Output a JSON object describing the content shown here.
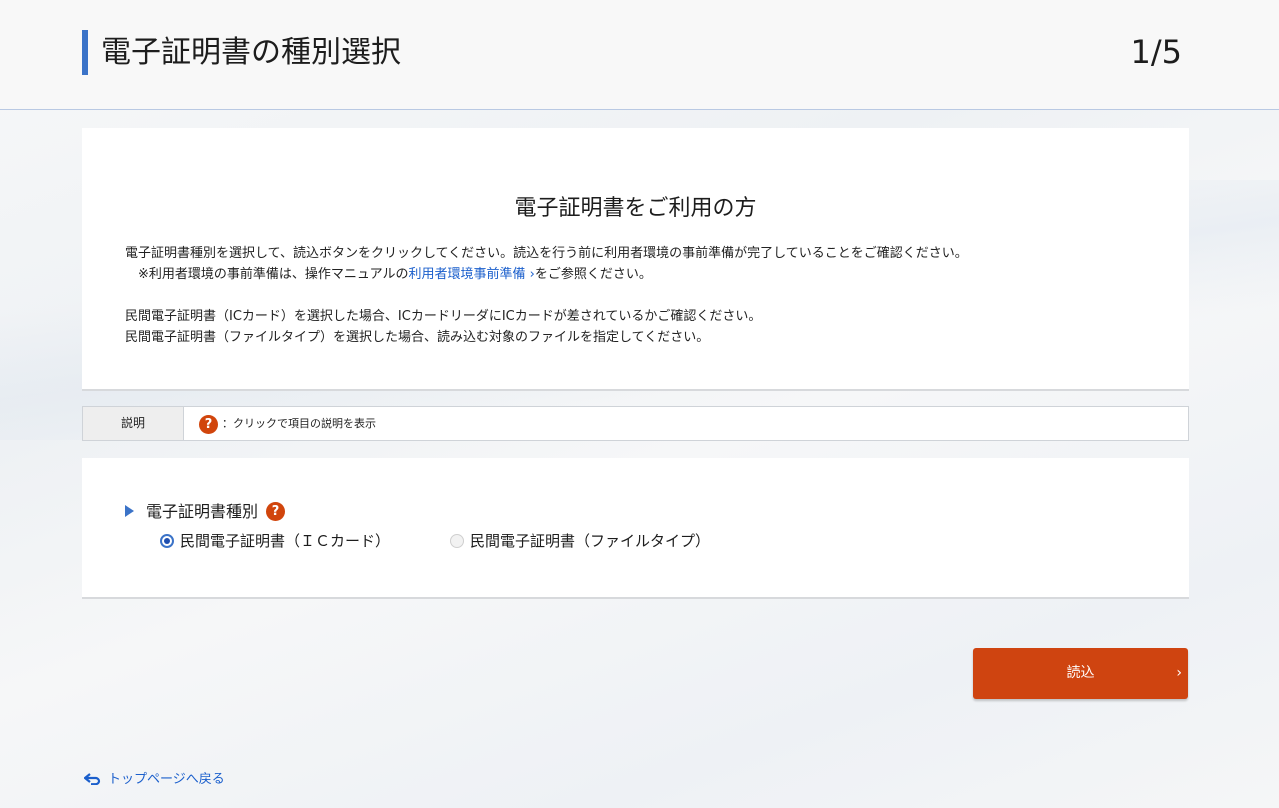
{
  "header": {
    "title": "電子証明書の種別選択",
    "step": "1/5"
  },
  "info": {
    "title": "電子証明書をご利用の方",
    "line1": "電子証明書種別を選択して、読込ボタンをクリックしてください。読込を行う前に利用者環境の事前準備が完了していることをご確認ください。",
    "line2_prefix": "※利用者環境の事前準備は、操作マニュアルの",
    "line2_link": "利用者環境事前準備",
    "line2_suffix": "をご参照ください。",
    "line3": "民間電子証明書（ICカード）を選択した場合、ICカードリーダにICカードが差されているかご確認ください。",
    "line4": "民間電子証明書（ファイルタイプ）を選択した場合、読み込む対象のファイルを指定してください。"
  },
  "description": {
    "label": "説明",
    "text": "：クリックで項目の説明を表示"
  },
  "form": {
    "field_label": "電子証明書種別",
    "options": [
      {
        "label": "民間電子証明書（ＩＣカード）",
        "selected": true
      },
      {
        "label": "民間電子証明書（ファイルタイプ）",
        "selected": false
      }
    ]
  },
  "buttons": {
    "read": "読込",
    "read_chevron": "›"
  },
  "footer": {
    "back_link": "トップページへ戻る"
  },
  "icons": {
    "help": "?",
    "link_chevron": "›"
  },
  "colors": {
    "accent": "#3b73c8",
    "primary_button": "#cf4410",
    "link": "#1b5fcc"
  }
}
